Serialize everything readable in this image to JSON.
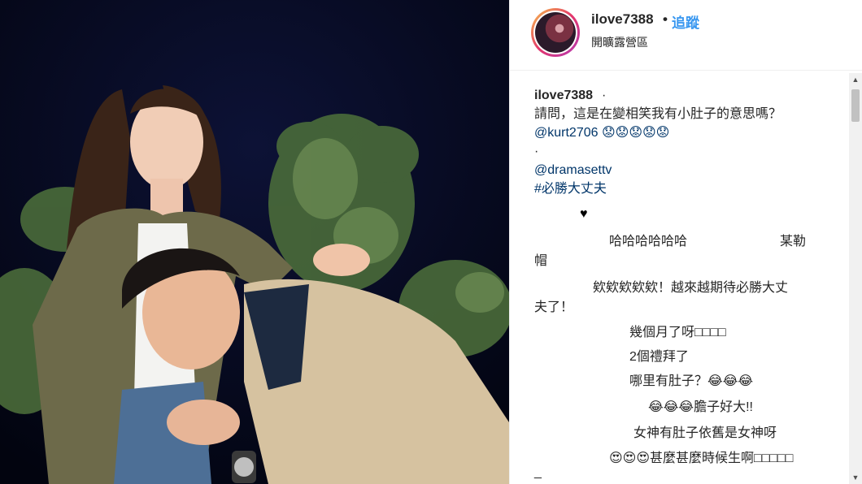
{
  "post": {
    "username": "ilove7388",
    "separator": "•",
    "follow_label": "追蹤",
    "location": "開曠露營區"
  },
  "caption": {
    "username": "ilove7388",
    "user_suffix": "·",
    "line1": "請問，這是在變相笑我有小肚子的意思嗎？",
    "mention_line": "@kurt2706 😟😟😟😟😟",
    "dot_line": "·",
    "mention2": "@dramasettv",
    "hashtag": "#必勝大丈夫"
  },
  "comments": {
    "heart": "♥",
    "c1a": "哈哈哈哈哈哈",
    "c1b": "某勒",
    "c1c": "帽",
    "c2a": "欸欸欸欸欸！越來越期待必勝大丈",
    "c2b": "夫了！",
    "c3": "幾個月了呀□□□□",
    "c4": "2個禮拜了",
    "c5": "哪里有肚子？😂😂😂",
    "c6": "😂😂😂膽子好大!!",
    "c7": "女神有肚子依舊是女神呀",
    "c8": "😍😍😍甚麼甚麼時候生啊□□□□□",
    "c9": "_"
  },
  "scrollbar": {
    "up_arrow": "▲",
    "down_arrow": "▼"
  },
  "icons": {
    "heart_color": "#000000",
    "follow_color": "#3897f0"
  }
}
